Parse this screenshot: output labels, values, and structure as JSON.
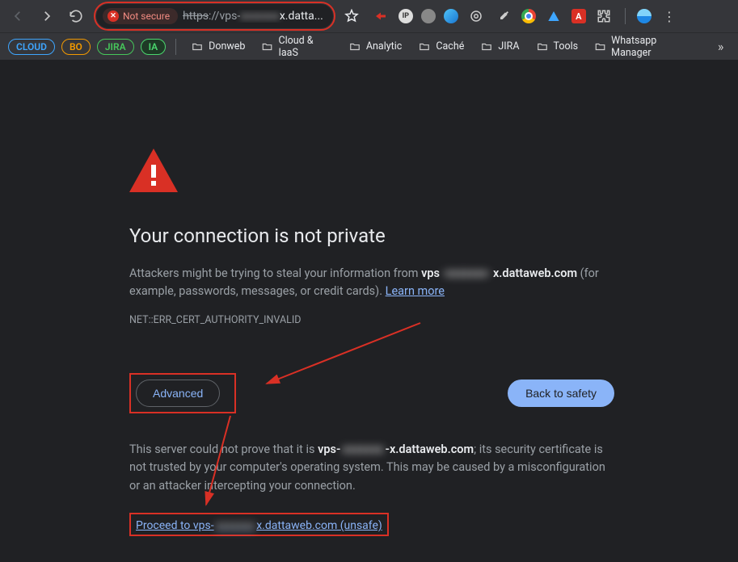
{
  "toolbar": {
    "not_secure_label": "Not secure",
    "url_scheme": "https",
    "url_prefix": "://vps-",
    "url_blur": "xxxxxxx",
    "url_suffix": "x.datta...",
    "star_icon": "star-icon"
  },
  "extensions": [
    "redirect",
    "ip",
    "grey-circle",
    "globe",
    "circle-ring",
    "eyedropper",
    "chrome",
    "triangle",
    "adobe",
    "puzzle",
    "sep",
    "avatar",
    "menu"
  ],
  "bookmarks": {
    "chips": [
      "CLOUD",
      "BO",
      "JIRA",
      "IA"
    ],
    "folders": [
      "Donweb",
      "Cloud & IaaS",
      "Analytic",
      "Caché",
      "JIRA",
      "Tools",
      "Whatsapp Manager"
    ]
  },
  "page": {
    "title": "Your connection is not private",
    "p1_a": "Attackers might be trying to steal your information from ",
    "p1_host_pre": "vps",
    "p1_host_blur": "-xxxxxxx-",
    "p1_host_post": "x.dattaweb.com",
    "p1_b": " (for example, passwords, messages, or credit cards). ",
    "learn_more": "Learn more",
    "error_code": "NET::ERR_CERT_AUTHORITY_INVALID",
    "advanced": "Advanced",
    "back_safety": "Back to safety",
    "detail_a": "This server could not prove that it is ",
    "detail_host_pre": "vps-",
    "detail_host_blur": "xxxxxxx",
    "detail_host_post": "-x.dattaweb.com",
    "detail_b": "; its security certificate is not trusted by your computer's operating system. This may be caused by a misconfiguration or an attacker intercepting your connection.",
    "proceed_pre": "Proceed to vps-",
    "proceed_blur": "xxxxxxx",
    "proceed_post": "x.dattaweb.com (unsafe)"
  }
}
